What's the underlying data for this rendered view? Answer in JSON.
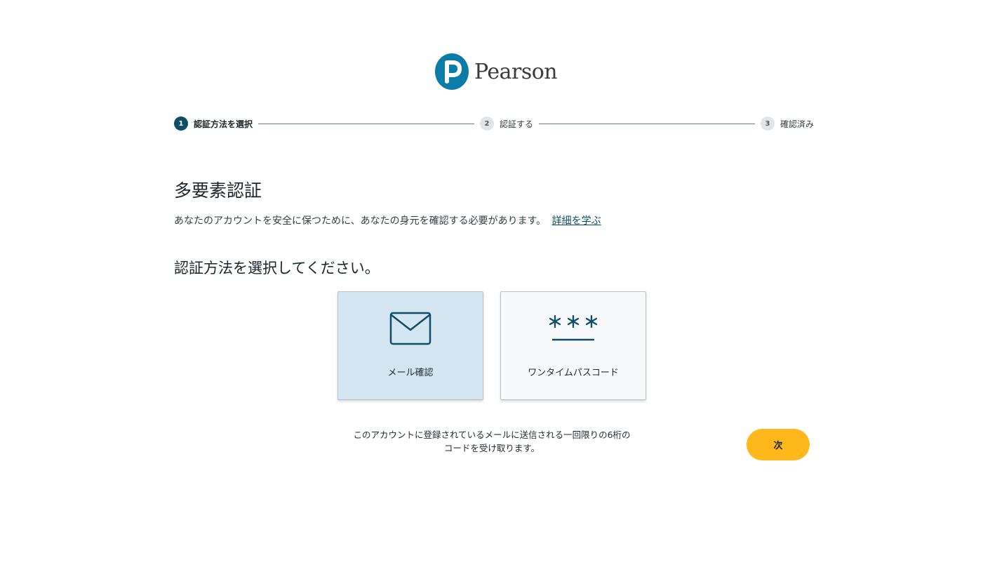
{
  "brand": {
    "name": "Pearson",
    "logo_letter": "P",
    "color": "#0b7ca8"
  },
  "stepper": {
    "steps": [
      {
        "number": "1",
        "label": "認証方法を選択",
        "state": "active"
      },
      {
        "number": "2",
        "label": "認証する",
        "state": "inactive"
      },
      {
        "number": "3",
        "label": "確認済み",
        "state": "inactive"
      }
    ]
  },
  "main": {
    "title": "多要素認証",
    "intro_text": "あなたのアカウントを安全に保つために、あなたの身元を確認する必要があります。",
    "learn_more_link": "詳細を学ぶ",
    "subtitle": "認証方法を選択してください。"
  },
  "options": [
    {
      "label": "メール確認",
      "icon": "envelope-icon",
      "selected": true
    },
    {
      "label": "ワンタイムパスコード",
      "icon": "passcode-icon",
      "selected": false
    }
  ],
  "description_line1": "このアカウントに登録されているメールに送信される一回限りの6桁の",
  "description_line2": "コードを受け取ります。",
  "next_button": "次",
  "colors": {
    "accent_dark": "#0d4d68",
    "selected_card": "#d3e6f2",
    "button": "#ffb81c"
  }
}
